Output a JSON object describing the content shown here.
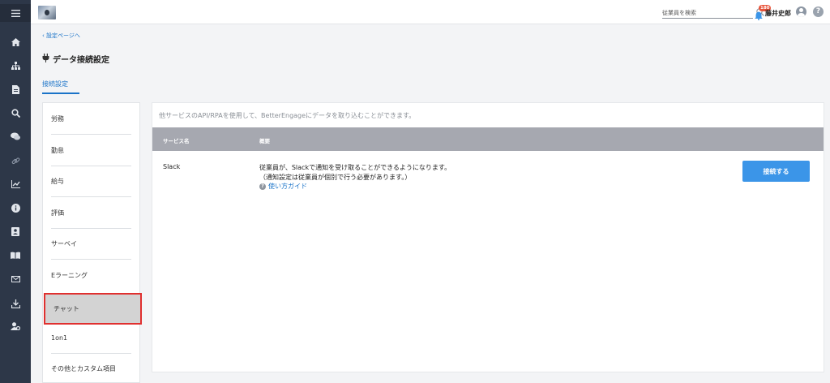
{
  "topbar": {
    "search_placeholder": "従業員を検索",
    "notification_count": "180",
    "user_name": "藤井史郎",
    "help_label": "?"
  },
  "sidebar_icons": [
    "menu-icon",
    "home-icon",
    "org-chart-icon",
    "document-icon",
    "search-icon",
    "chat-icon",
    "link-icon",
    "chart-icon",
    "info-icon",
    "contact-icon",
    "book-icon",
    "mail-icon",
    "download-icon",
    "user-settings-icon"
  ],
  "breadcrumb": {
    "back_label": "設定ページへ"
  },
  "page": {
    "title": "データ接続設定",
    "tab_label": "接続設定"
  },
  "menu": {
    "items": [
      {
        "label": "労務"
      },
      {
        "label": "勤怠"
      },
      {
        "label": "給与"
      },
      {
        "label": "評価"
      },
      {
        "label": "サーベイ"
      },
      {
        "label": "Eラーニング"
      },
      {
        "label": "チャット",
        "selected": true
      },
      {
        "label": "1on1"
      },
      {
        "label": "その他とカスタム項目"
      }
    ]
  },
  "content": {
    "description": "他サービスのAPI/RPAを使用して、BetterEngageにデータを取り込むことができます。",
    "columns": [
      "サービス名",
      "概要"
    ],
    "rows": [
      {
        "service": "Slack",
        "overview_line1": "従業員が、Slackで通知を受け取ることができるようになります。",
        "overview_line2": "（通知設定は従業員が個別で行う必要があります。）",
        "guide_label": "使い方ガイド",
        "button_label": "接続する"
      }
    ]
  }
}
